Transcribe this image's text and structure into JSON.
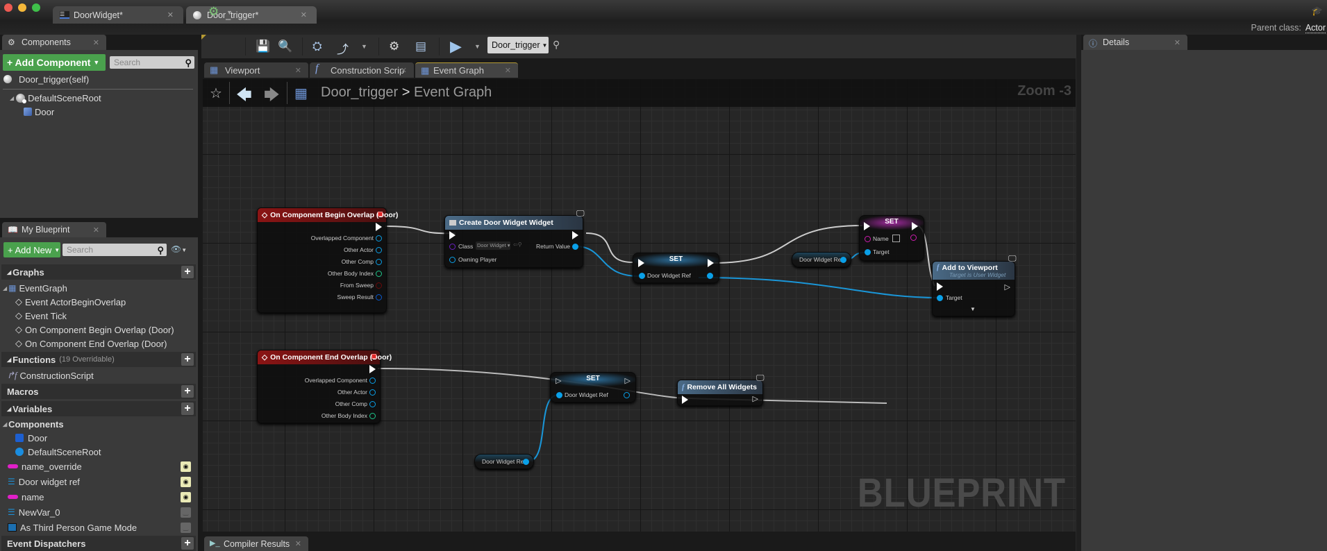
{
  "window": {
    "tabs": [
      {
        "label": "DoorWidget*",
        "icon": "widget-blueprint-icon"
      },
      {
        "label": "Door_trigger*",
        "icon": "actor-sphere-icon",
        "active": true
      }
    ],
    "parent_class_label": "Parent class:",
    "parent_class_value": "Actor"
  },
  "components_panel": {
    "tab_label": "Components",
    "add_button": "+ Add Component",
    "search_placeholder": "Search",
    "self_item": "Door_trigger(self)",
    "tree": [
      {
        "label": "DefaultSceneRoot",
        "icon": "scene-root-icon"
      },
      {
        "label": "Door",
        "icon": "static-mesh-icon"
      }
    ]
  },
  "toolbar": {
    "debug_object": "Door_trigger",
    "buttons": [
      "compile",
      "save",
      "find",
      "class-settings",
      "class-defaults",
      "simulation",
      "play"
    ]
  },
  "graph_tabs": [
    {
      "label": "Viewport",
      "icon": "viewport-icon"
    },
    {
      "label": "Construction Scrip",
      "icon": "function-icon"
    },
    {
      "label": "Event Graph",
      "icon": "event-graph-icon",
      "active": true
    }
  ],
  "graph": {
    "breadcrumb": {
      "root": "Door_trigger",
      "separator": ">",
      "current": "Event Graph"
    },
    "zoom_label": "Zoom -3",
    "watermark": "BLUEPRINT",
    "nodes": {
      "begin_overlap": {
        "title": "On Component Begin Overlap (Door)",
        "pins": [
          "Overlapped Component",
          "Other Actor",
          "Other Comp",
          "Other Body Index",
          "From Sweep",
          "Sweep Result"
        ]
      },
      "create_widget": {
        "title": "Create Door Widget Widget",
        "class_label": "Class",
        "class_value": "Door Widget",
        "owning_player": "Owning Player",
        "return_value": "Return Value"
      },
      "set1": {
        "title": "SET",
        "pin": "Door Widget Ref"
      },
      "set_name": {
        "title": "SET",
        "name_pin": "Name",
        "target_pin": "Target"
      },
      "var_ref_1": {
        "label": "Door Widget Ref"
      },
      "add_to_viewport": {
        "title": "Add to Viewport",
        "subtitle": "Target is User Widget",
        "target": "Target"
      },
      "end_overlap": {
        "title": "On Component End Overlap (Door)",
        "pins": [
          "Overlapped Component",
          "Other Actor",
          "Other Comp",
          "Other Body Index"
        ]
      },
      "set2": {
        "title": "SET",
        "pin": "Door Widget Ref"
      },
      "remove_widgets": {
        "title": "Remove All Widgets"
      },
      "var_ref_2": {
        "label": "Door Widget Ref"
      }
    }
  },
  "my_blueprint": {
    "tab_label": "My Blueprint",
    "add_button": "+ Add New",
    "search_placeholder": "Search",
    "sections": {
      "graphs": "Graphs",
      "functions": "Functions",
      "functions_note": "(19 Overridable)",
      "macros": "Macros",
      "variables": "Variables",
      "components": "Components",
      "event_dispatchers": "Event Dispatchers"
    },
    "event_graph": "EventGraph",
    "events": [
      "Event ActorBeginOverlap",
      "Event Tick",
      "On Component Begin Overlap (Door)",
      "On Component End Overlap (Door)"
    ],
    "functions": [
      "ConstructionScript"
    ],
    "component_vars": [
      "Door",
      "DefaultSceneRoot"
    ],
    "variables": [
      {
        "label": "name_override",
        "color": "#e020c8",
        "type": "name",
        "public": true
      },
      {
        "label": "Door widget ref",
        "color": "#1c8fd6",
        "type": "object",
        "public": true
      },
      {
        "label": "name",
        "color": "#e020c8",
        "type": "name",
        "public": true
      },
      {
        "label": "NewVar_0",
        "color": "#1c8fd6",
        "type": "object",
        "public": false
      },
      {
        "label": "As Third Person Game Mode",
        "color": "#1c8fd6",
        "type": "class",
        "public": false
      }
    ]
  },
  "details_panel": {
    "tab_label": "Details"
  },
  "bottom": {
    "compiler_results": "Compiler Results"
  }
}
